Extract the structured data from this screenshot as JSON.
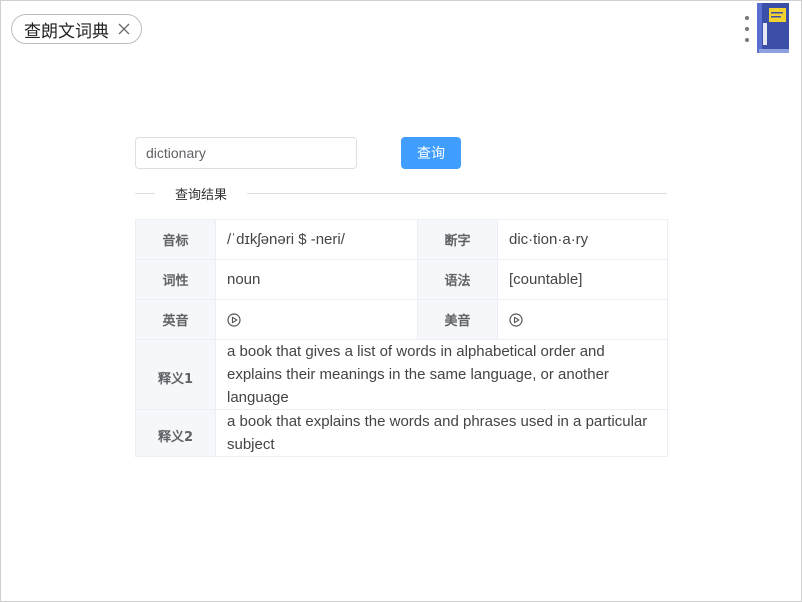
{
  "tab": {
    "title": "查朗文词典"
  },
  "search": {
    "value": "dictionary",
    "button_label": "查询"
  },
  "divider_label": "查询结果",
  "rows": {
    "pron_label": "音标",
    "pron_value": "/ˈdɪkʃənəri $ -neri/",
    "hyph_label": "断字",
    "hyph_value": "dic·tion·a·ry",
    "pos_label": "词性",
    "pos_value": "noun",
    "gram_label": "语法",
    "gram_value": "[countable]",
    "uk_label": "英音",
    "uk_icon": "play-circle-icon",
    "us_label": "美音",
    "us_icon": "play-circle-icon",
    "def1_label": "释义1",
    "def1_value": "a book that gives a list of words in alphabetical order and explains their meanings in the same language, or another language",
    "def2_label": "释义2",
    "def2_value": "a book that explains the words and phrases used in a particular subject"
  },
  "colors": {
    "primary": "#409eff",
    "label_bg": "#f5f7fa",
    "border": "#ebeef5"
  }
}
